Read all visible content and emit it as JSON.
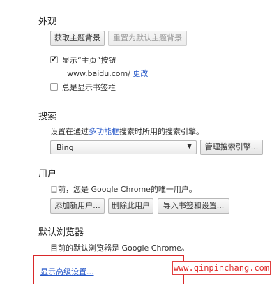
{
  "appearance": {
    "title": "外观",
    "get_theme_label": "获取主题背景",
    "reset_theme_label": "重置为默认主题背景",
    "show_home_label": "显示“主页”按钮",
    "show_home_checked": true,
    "home_url": "www.baidu.com/",
    "home_change_label": "更改",
    "bookmarks_bar_label": "总是显示书签栏",
    "bookmarks_bar_checked": false
  },
  "search": {
    "title": "搜索",
    "desc_before": "设置在通过",
    "desc_link": "多功能框",
    "desc_after": "搜索时所用的搜索引擎。",
    "engine_selected": "Bing",
    "manage_label": "管理搜索引擎..."
  },
  "users": {
    "title": "用户",
    "desc": "目前，您是 Google Chrome的唯一用户。",
    "add_user_label": "添加新用户...",
    "delete_user_label": "删除此用户",
    "import_label": "导入书签和设置..."
  },
  "default_browser": {
    "title": "默认浏览器",
    "desc": "目前的默认浏览器是 Google Chrome。"
  },
  "advanced": {
    "link_label": "显示高级设置..."
  },
  "watermark": {
    "text": "www.qinpinchang.com",
    "color": "#e02a2a"
  },
  "colors": {
    "link": "#2456c8",
    "highlight_border": "#d9282a"
  }
}
